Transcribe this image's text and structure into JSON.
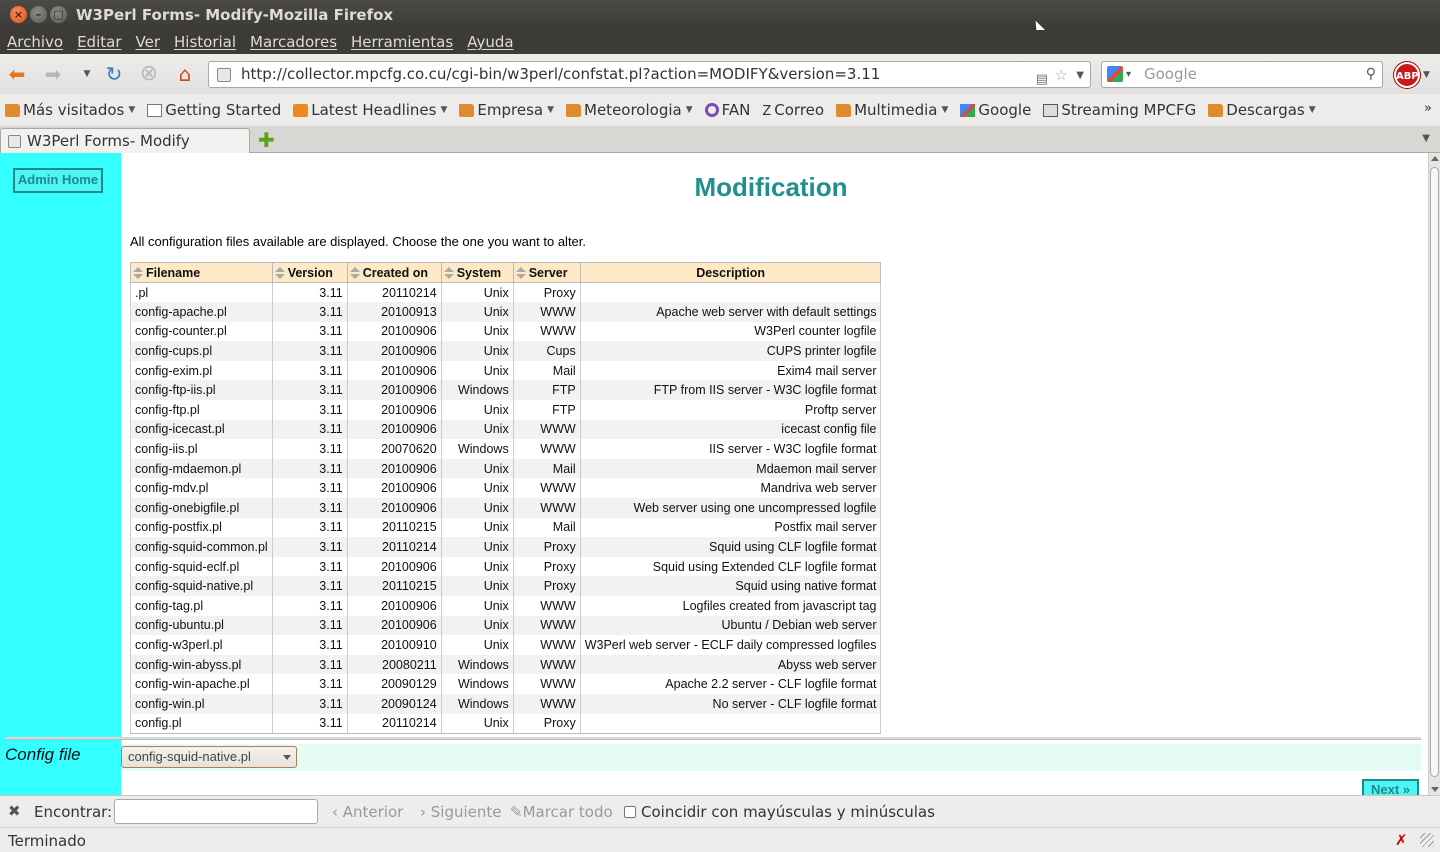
{
  "window": {
    "title": "W3Perl Forms- Modify-Mozilla Firefox"
  },
  "menu": [
    "Archivo",
    "Editar",
    "Ver",
    "Historial",
    "Marcadores",
    "Herramientas",
    "Ayuda"
  ],
  "toolbar": {
    "url": "http://collector.mpcfg.co.cu/cgi-bin/w3perl/confstat.pl?action=MODIFY&version=3.11",
    "search_placeholder": "Google",
    "adblock_label": "ABP"
  },
  "bookmarks": [
    {
      "label": "Más visitados",
      "icon": "folder-icon",
      "dropdown": true
    },
    {
      "label": "Getting Started",
      "icon": "page-icon",
      "dropdown": false
    },
    {
      "label": "Latest Headlines",
      "icon": "rss-icon",
      "dropdown": true
    },
    {
      "label": "Empresa",
      "icon": "folder-icon",
      "dropdown": true
    },
    {
      "label": "Meteorologia",
      "icon": "folder-icon",
      "dropdown": true
    },
    {
      "label": "FAN",
      "icon": "fan-icon",
      "dropdown": false
    },
    {
      "label": "Correo",
      "icon": "correo-icon",
      "dropdown": false
    },
    {
      "label": "Multimedia",
      "icon": "folder-icon",
      "dropdown": true
    },
    {
      "label": "Google",
      "icon": "google-icon",
      "dropdown": false
    },
    {
      "label": "Streaming MPCFG",
      "icon": "stream-icon",
      "dropdown": false
    },
    {
      "label": "Descargas",
      "icon": "folder-icon",
      "dropdown": true
    }
  ],
  "tab": {
    "label": "W3Perl Forms- Modify"
  },
  "page": {
    "admin_home": "Admin Home",
    "title": "Modification",
    "intro": "All configuration files available are displayed. Choose the one you want to alter.",
    "config_label": "Config file",
    "config_selected": "config-squid-native.pl",
    "next_button": "Next »"
  },
  "table": {
    "headers": [
      "Filename",
      "Version",
      "Created on",
      "System",
      "Server",
      "Description"
    ],
    "rows": [
      [
        ".pl",
        "3.11",
        "20110214",
        "Unix",
        "Proxy",
        ""
      ],
      [
        "config-apache.pl",
        "3.11",
        "20100913",
        "Unix",
        "WWW",
        "Apache web server with default settings"
      ],
      [
        "config-counter.pl",
        "3.11",
        "20100906",
        "Unix",
        "WWW",
        "W3Perl counter logfile"
      ],
      [
        "config-cups.pl",
        "3.11",
        "20100906",
        "Unix",
        "Cups",
        "CUPS printer logfile"
      ],
      [
        "config-exim.pl",
        "3.11",
        "20100906",
        "Unix",
        "Mail",
        "Exim4 mail server"
      ],
      [
        "config-ftp-iis.pl",
        "3.11",
        "20100906",
        "Windows",
        "FTP",
        "FTP from IIS server - W3C logfile format"
      ],
      [
        "config-ftp.pl",
        "3.11",
        "20100906",
        "Unix",
        "FTP",
        "Proftp server"
      ],
      [
        "config-icecast.pl",
        "3.11",
        "20100906",
        "Unix",
        "WWW",
        "icecast config file"
      ],
      [
        "config-iis.pl",
        "3.11",
        "20070620",
        "Windows",
        "WWW",
        "IIS server - W3C logfile format"
      ],
      [
        "config-mdaemon.pl",
        "3.11",
        "20100906",
        "Unix",
        "Mail",
        "Mdaemon mail server"
      ],
      [
        "config-mdv.pl",
        "3.11",
        "20100906",
        "Unix",
        "WWW",
        "Mandriva web server"
      ],
      [
        "config-onebigfile.pl",
        "3.11",
        "20100906",
        "Unix",
        "WWW",
        "Web server using one uncompressed logfile"
      ],
      [
        "config-postfix.pl",
        "3.11",
        "20110215",
        "Unix",
        "Mail",
        "Postfix mail server"
      ],
      [
        "config-squid-common.pl",
        "3.11",
        "20110214",
        "Unix",
        "Proxy",
        "Squid using CLF logfile format"
      ],
      [
        "config-squid-eclf.pl",
        "3.11",
        "20100906",
        "Unix",
        "Proxy",
        "Squid using Extended CLF logfile format"
      ],
      [
        "config-squid-native.pl",
        "3.11",
        "20110215",
        "Unix",
        "Proxy",
        "Squid using native format"
      ],
      [
        "config-tag.pl",
        "3.11",
        "20100906",
        "Unix",
        "WWW",
        "Logfiles created from javascript tag"
      ],
      [
        "config-ubuntu.pl",
        "3.11",
        "20100906",
        "Unix",
        "WWW",
        "Ubuntu / Debian web server"
      ],
      [
        "config-w3perl.pl",
        "3.11",
        "20100910",
        "Unix",
        "WWW",
        "W3Perl web server - ECLF daily compressed logfiles"
      ],
      [
        "config-win-abyss.pl",
        "3.11",
        "20080211",
        "Windows",
        "WWW",
        "Abyss web server"
      ],
      [
        "config-win-apache.pl",
        "3.11",
        "20090129",
        "Windows",
        "WWW",
        "Apache 2.2 server - CLF logfile format"
      ],
      [
        "config-win.pl",
        "3.11",
        "20090124",
        "Windows",
        "WWW",
        "No server - CLF logfile format"
      ],
      [
        "config.pl",
        "3.11",
        "20110214",
        "Unix",
        "Proxy",
        ""
      ]
    ]
  },
  "findbar": {
    "label": "Encontrar:",
    "prev": "Anterior",
    "next": "Siguiente",
    "highlight": "Marcar todo",
    "match_case": "Coincidir con mayúsculas y minúsculas"
  },
  "status": {
    "text": "Terminado"
  },
  "colors": {
    "sidebar": "#33ffff",
    "title": "#1f8f8f",
    "table_header": "#fde9c6"
  }
}
